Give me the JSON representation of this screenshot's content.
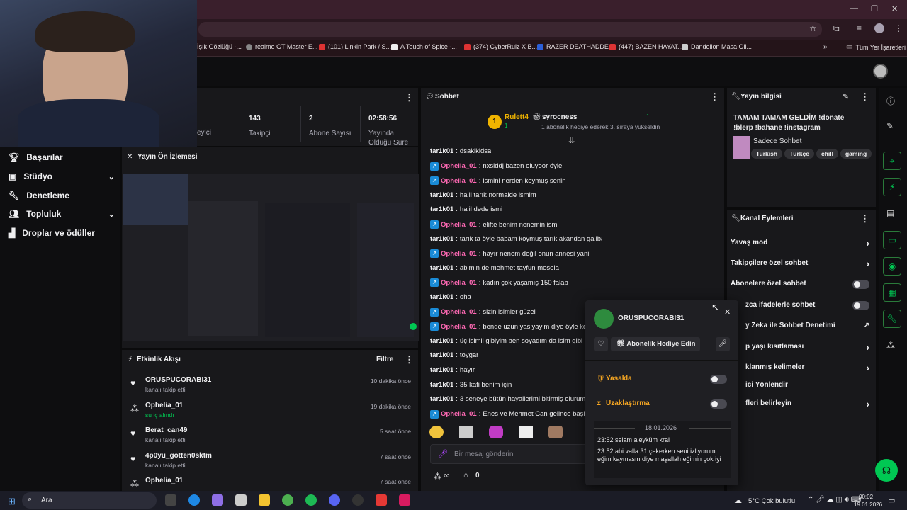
{
  "browser": {
    "bookmarks": [
      {
        "label": "İşık Gözlüğü -...",
        "color": "#555"
      },
      {
        "label": "realme GT Master E...",
        "color": "#888"
      },
      {
        "label": "(101) Linkin Park / S...",
        "color": "#e53935"
      },
      {
        "label": "A Touch of Spice -...",
        "color": "#eee"
      },
      {
        "label": "(374) CyberRulz X B...",
        "color": "#e53935"
      },
      {
        "label": "RAZER DEATHADDE...",
        "color": "#2b5fd9"
      },
      {
        "label": "(447) BAZEN HAYAT...",
        "color": "#e53935"
      },
      {
        "label": "Dandelion Masa Oli...",
        "color": "#ccc"
      }
    ],
    "all_bookmarks": "Tüm Yer İşaretleri"
  },
  "stats": {
    "partial_label": "eyici",
    "followers": {
      "value": "143",
      "label": "Takipçi"
    },
    "subs": {
      "value": "2",
      "label": "Abone Sayısı"
    },
    "uptime": {
      "value": "02:58:56",
      "label": "Yayında Olduğu Süre"
    }
  },
  "nav": {
    "items": [
      {
        "label": "Başarılar",
        "icon": "trophy-icon",
        "chev": ""
      },
      {
        "label": "Stüdyo",
        "icon": "studio-icon",
        "chev": "⌄"
      },
      {
        "label": "Denetleme",
        "icon": "wrench-icon",
        "chev": ""
      },
      {
        "label": "Topluluk",
        "icon": "community-icon",
        "chev": "⌄"
      },
      {
        "label": "Droplar ve ödüller",
        "icon": "drops-icon",
        "chev": ""
      }
    ]
  },
  "preview": {
    "title": "Yayın Ön İzlemesi"
  },
  "activity": {
    "title": "Etkinlik Akışı",
    "filter": "Filtre",
    "items": [
      {
        "name": "ORUSPUCORABI31",
        "sub": "kanalı takip etti",
        "time": "10 dakika önce",
        "icon": "♥",
        "accent": false
      },
      {
        "name": "Ophelia_01",
        "sub": "su iç alındı",
        "time": "19 dakika önce",
        "icon": "⁂",
        "accent": true
      },
      {
        "name": "Berat_can49",
        "sub": "kanalı takip etti",
        "time": "5 saat önce",
        "icon": "♥",
        "accent": false
      },
      {
        "name": "4p0yu_gotten0sktm",
        "sub": "kanalı takip etti",
        "time": "7 saat önce",
        "icon": "♥",
        "accent": false
      },
      {
        "name": "Ophelia_01",
        "sub": "",
        "time": "7 saat önce",
        "icon": "⁂",
        "accent": false
      }
    ]
  },
  "chat": {
    "title": "Sohbet",
    "gifter1": {
      "rank": "1",
      "name": "Rulett4",
      "count": "1"
    },
    "gifter2": {
      "name": "syrocness",
      "count": "1",
      "note": "1 abonelik hediye ederek 3. sıraya yükseldin"
    },
    "messages": [
      {
        "user": "tar1k01",
        "text": "dsaklkldsa",
        "pink": false
      },
      {
        "user": "Ophelia_01",
        "text": "nxsiddj bazen oluyoor öyle",
        "pink": true
      },
      {
        "user": "Ophelia_01",
        "text": "ismini nerden koymuş senin",
        "pink": true
      },
      {
        "user": "tar1k01",
        "text": "halil tarık normalde ismim",
        "pink": false
      },
      {
        "user": "tar1k01",
        "text": "halil dede ismi",
        "pink": false
      },
      {
        "user": "Ophelia_01",
        "text": "elifte benim nenemin ismi",
        "pink": true
      },
      {
        "user": "tar1k01",
        "text": "tarık ta öyle babam koymuş tarık akandan galiba",
        "pink": false
      },
      {
        "user": "Ophelia_01",
        "text": "hayır nenem değil onun annesi yani",
        "pink": true
      },
      {
        "user": "tar1k01",
        "text": "abimin de mehmet tayfun mesela",
        "pink": false
      },
      {
        "user": "Ophelia_01",
        "text": "kadın çok yaşamış 150 falab",
        "pink": true
      },
      {
        "user": "tar1k01",
        "text": "oha",
        "pink": false
      },
      {
        "user": "Ophelia_01",
        "text": "sizin isimler güzel",
        "pink": true
      },
      {
        "user": "Ophelia_01",
        "text": "bende uzun yasiyayim diye öyle ko",
        "pink": true
      },
      {
        "user": "tar1k01",
        "text": "üç isimli gibiyim ben soyadım da isim gibi",
        "pink": false
      },
      {
        "user": "tar1k01",
        "text": "toygar",
        "pink": false
      },
      {
        "user": "tar1k01",
        "text": "hayır",
        "pink": false
      },
      {
        "user": "tar1k01",
        "text": "35 kafi benim için",
        "pink": false
      },
      {
        "user": "tar1k01",
        "text": "3 seneye bütün hayallerimi bitirmiş olurum",
        "pink": false
      },
      {
        "user": "Ophelia_01",
        "text": "Enes ve Mehmet Can gelince başla",
        "pink": true
      }
    ],
    "input_placeholder": "Bir mesaj gönderin",
    "points": "0",
    "infinity": "∞"
  },
  "stream_info": {
    "title": "Yayın bilgisi",
    "stream_title": "TAMAM TAMAM GELDİM !donate !blerp !bahane !instagram",
    "category": "Sadece Sohbet",
    "tags": [
      "Turkish",
      "Türkçe",
      "chill",
      "gaming"
    ]
  },
  "channel_actions": {
    "title": "Kanal Eylemleri",
    "rows": [
      {
        "label": "Yavaş mod",
        "control": "arrow"
      },
      {
        "label": "Takipçilere özel sohbet",
        "control": "arrow"
      },
      {
        "label": "Abonelere özel sohbet",
        "control": "toggle"
      },
      {
        "label": "zca ifadelerle sohbet",
        "control": "toggle"
      },
      {
        "label": "y Zeka ile Sohbet Denetimi",
        "control": "ext"
      },
      {
        "label": "p yaşı kısıtlaması",
        "control": "arrow"
      },
      {
        "label": "klanmış kelimeler",
        "control": "arrow"
      },
      {
        "label": "ici Yönlendir",
        "control": "none"
      },
      {
        "label": "fleri belirleyin",
        "control": "arrow"
      }
    ]
  },
  "user_card": {
    "username": "ORUSPUCORABI31",
    "gift_btn": "Abonelik Hediye Edin",
    "ban": "Yasakla",
    "timeout": "Uzaklaştırma",
    "date": "18.01.2026",
    "logs": [
      "23:52 selam aleyküm kral",
      "23:52 abi valla 31 çekerken seni izliyorum eğim kaymasın diye maşallah eğimin çok iyi"
    ]
  },
  "taskbar": {
    "search": "Ara",
    "weather": "5°C  Çok bulutlu",
    "time": "00:02",
    "date": "19.01.2026"
  },
  "colors": {
    "accent_green": "#00c853",
    "pink_user": "#ff69b4",
    "gold": "#f0b400",
    "panel": "#18181b"
  }
}
